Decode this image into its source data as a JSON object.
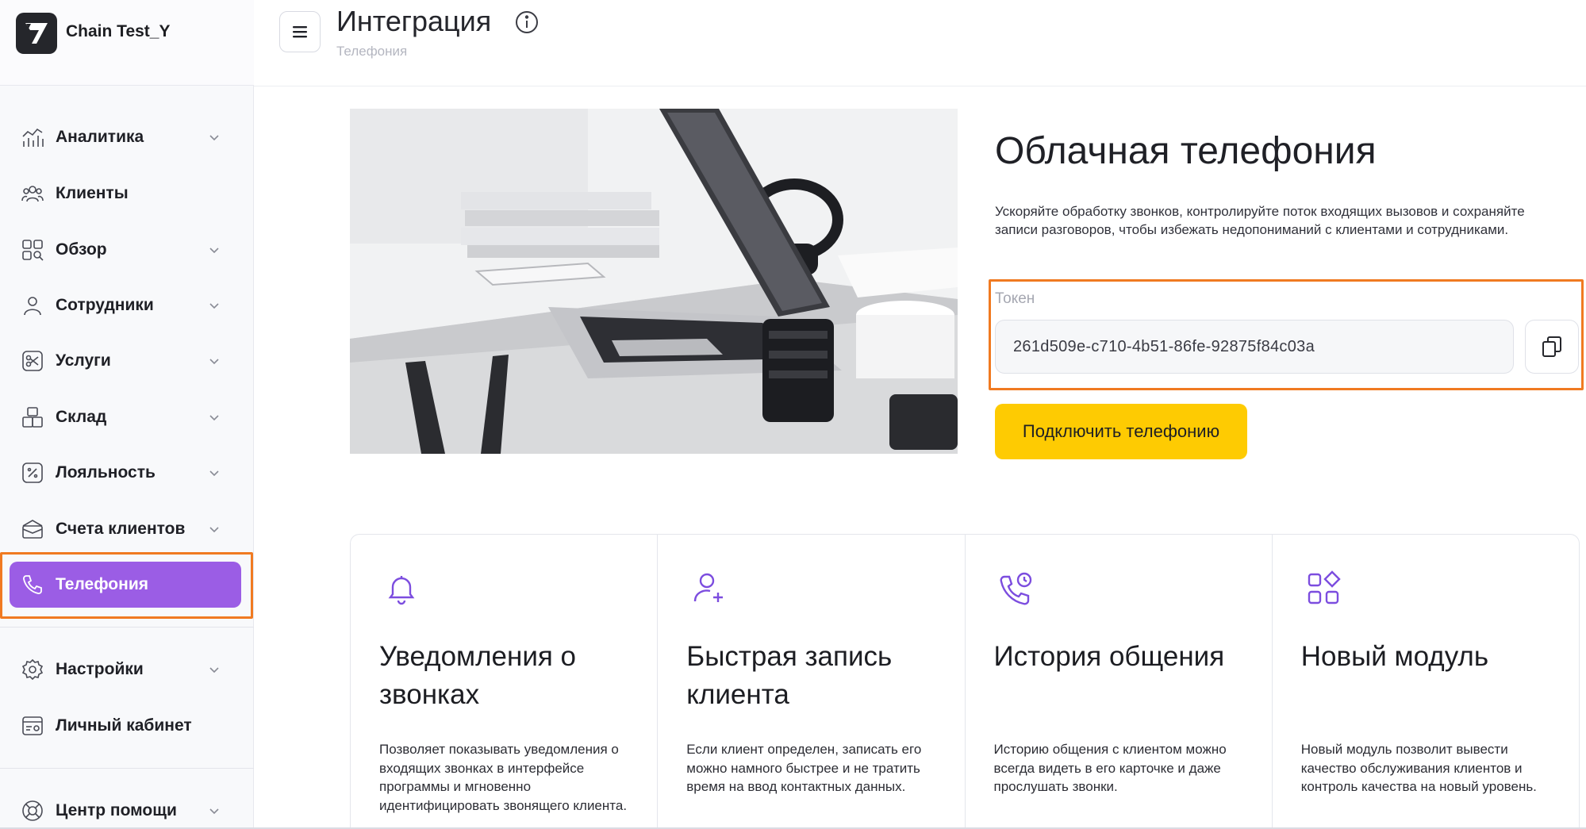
{
  "brand": {
    "name": "Chain Test_Y"
  },
  "header": {
    "title": "Интеграция",
    "breadcrumb": "Телефония"
  },
  "sidebar": {
    "items": [
      {
        "label": "Аналитика",
        "icon": "analytics-icon"
      },
      {
        "label": "Клиенты",
        "icon": "clients-icon"
      },
      {
        "label": "Обзор",
        "icon": "overview-icon"
      },
      {
        "label": "Сотрудники",
        "icon": "employees-icon"
      },
      {
        "label": "Услуги",
        "icon": "services-icon"
      },
      {
        "label": "Склад",
        "icon": "warehouse-icon"
      },
      {
        "label": "Лояльность",
        "icon": "loyalty-icon"
      },
      {
        "label": "Счета клиентов",
        "icon": "client-accounts-icon"
      },
      {
        "label": "Телефония",
        "icon": "phone-icon",
        "active": true
      },
      {
        "label": "Настройки",
        "icon": "settings-icon"
      },
      {
        "label": "Личный кабинет",
        "icon": "personal-account-icon"
      },
      {
        "label": "Центр помощи",
        "icon": "help-center-icon"
      }
    ]
  },
  "hero": {
    "title": "Облачная телефония",
    "description": "Ускоряйте обработку звонков, контролируйте поток входящих вызовов и сохраняйте записи разговоров, чтобы избежать недопониманий с клиентами и сотрудниками.",
    "token_label": "Токен",
    "token_value": "261d509e-c710-4b51-86fe-92875f84c03a",
    "connect_label": "Подключить телефонию"
  },
  "features": [
    {
      "title": "Уведомления о звонках",
      "description": "Позволяет показывать уведомления о входящих звонках в интерфейсе программы и мгновенно идентифицировать звонящего клиента.",
      "icon": "bell-icon"
    },
    {
      "title": "Быстрая запись клиента",
      "description": "Если клиент определен, записать его можно намного быстрее и не тратить время на ввод контактных данных.",
      "icon": "user-plus-icon"
    },
    {
      "title": "История общения",
      "description": "Историю общения с клиентом можно всегда видеть в его карточке и даже прослушать звонки.",
      "icon": "phone-history-icon"
    },
    {
      "title": "Новый модуль",
      "description": "Новый модуль позволит вывести качество обслуживания клиентов и контроль качества на новый уровень.",
      "icon": "modules-icon"
    }
  ],
  "colors": {
    "accent": "#9b5de5",
    "highlight": "#f07a21",
    "button": "#fecb02",
    "icon": "#7c4ddf"
  }
}
